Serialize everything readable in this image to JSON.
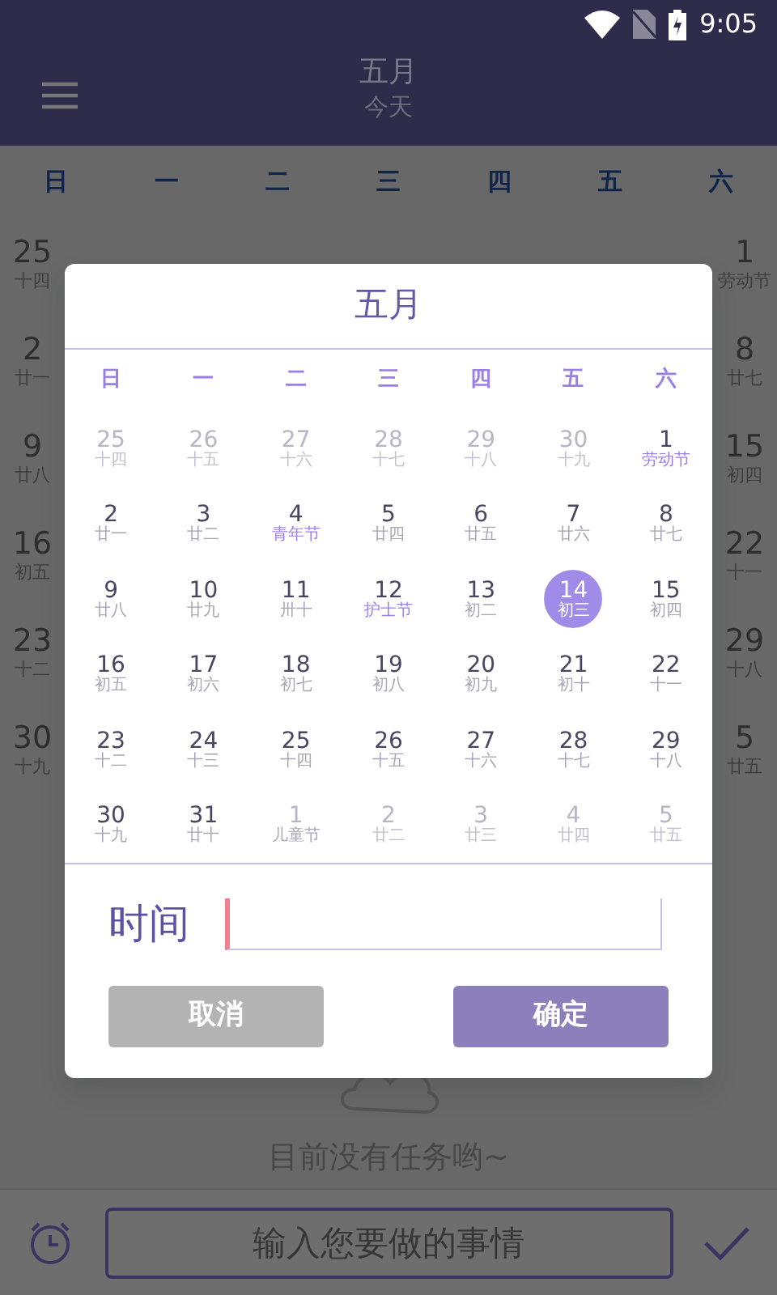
{
  "status_bar": {
    "time": "9:05"
  },
  "header": {
    "title": "五月",
    "subtitle": "今天"
  },
  "background_calendar": {
    "weekdays": [
      "日",
      "一",
      "二",
      "三",
      "四",
      "五",
      "六"
    ],
    "left_column": [
      {
        "day": "25",
        "lunar": "十四"
      },
      {
        "day": "2",
        "lunar": "廿一"
      },
      {
        "day": "9",
        "lunar": "廿八"
      },
      {
        "day": "16",
        "lunar": "初五"
      },
      {
        "day": "23",
        "lunar": "十二"
      },
      {
        "day": "30",
        "lunar": "十九"
      }
    ],
    "right_column": [
      {
        "day": "1",
        "lunar": "劳动节"
      },
      {
        "day": "8",
        "lunar": "廿七"
      },
      {
        "day": "15",
        "lunar": "初四"
      },
      {
        "day": "22",
        "lunar": "十一"
      },
      {
        "day": "29",
        "lunar": "十八"
      },
      {
        "day": "5",
        "lunar": "廿五"
      }
    ]
  },
  "empty_message": "目前没有任务哟~",
  "task_input": {
    "placeholder": "输入您要做的事情"
  },
  "dialog": {
    "title": "五月",
    "weekdays": [
      "日",
      "一",
      "二",
      "三",
      "四",
      "五",
      "六"
    ],
    "days": [
      {
        "day": "25",
        "lunar": "十四",
        "in_month": false,
        "festival": false,
        "selected": false
      },
      {
        "day": "26",
        "lunar": "十五",
        "in_month": false,
        "festival": false,
        "selected": false
      },
      {
        "day": "27",
        "lunar": "十六",
        "in_month": false,
        "festival": false,
        "selected": false
      },
      {
        "day": "28",
        "lunar": "十七",
        "in_month": false,
        "festival": false,
        "selected": false
      },
      {
        "day": "29",
        "lunar": "十八",
        "in_month": false,
        "festival": false,
        "selected": false
      },
      {
        "day": "30",
        "lunar": "十九",
        "in_month": false,
        "festival": false,
        "selected": false
      },
      {
        "day": "1",
        "lunar": "劳动节",
        "in_month": true,
        "festival": true,
        "selected": false
      },
      {
        "day": "2",
        "lunar": "廿一",
        "in_month": true,
        "festival": false,
        "selected": false
      },
      {
        "day": "3",
        "lunar": "廿二",
        "in_month": true,
        "festival": false,
        "selected": false
      },
      {
        "day": "4",
        "lunar": "青年节",
        "in_month": true,
        "festival": true,
        "selected": false
      },
      {
        "day": "5",
        "lunar": "廿四",
        "in_month": true,
        "festival": false,
        "selected": false
      },
      {
        "day": "6",
        "lunar": "廿五",
        "in_month": true,
        "festival": false,
        "selected": false
      },
      {
        "day": "7",
        "lunar": "廿六",
        "in_month": true,
        "festival": false,
        "selected": false
      },
      {
        "day": "8",
        "lunar": "廿七",
        "in_month": true,
        "festival": false,
        "selected": false
      },
      {
        "day": "9",
        "lunar": "廿八",
        "in_month": true,
        "festival": false,
        "selected": false
      },
      {
        "day": "10",
        "lunar": "廿九",
        "in_month": true,
        "festival": false,
        "selected": false
      },
      {
        "day": "11",
        "lunar": "卅十",
        "in_month": true,
        "festival": false,
        "selected": false
      },
      {
        "day": "12",
        "lunar": "护士节",
        "in_month": true,
        "festival": true,
        "selected": false
      },
      {
        "day": "13",
        "lunar": "初二",
        "in_month": true,
        "festival": false,
        "selected": false
      },
      {
        "day": "14",
        "lunar": "初三",
        "in_month": true,
        "festival": false,
        "selected": true
      },
      {
        "day": "15",
        "lunar": "初四",
        "in_month": true,
        "festival": false,
        "selected": false
      },
      {
        "day": "16",
        "lunar": "初五",
        "in_month": true,
        "festival": false,
        "selected": false
      },
      {
        "day": "17",
        "lunar": "初六",
        "in_month": true,
        "festival": false,
        "selected": false
      },
      {
        "day": "18",
        "lunar": "初七",
        "in_month": true,
        "festival": false,
        "selected": false
      },
      {
        "day": "19",
        "lunar": "初八",
        "in_month": true,
        "festival": false,
        "selected": false
      },
      {
        "day": "20",
        "lunar": "初九",
        "in_month": true,
        "festival": false,
        "selected": false
      },
      {
        "day": "21",
        "lunar": "初十",
        "in_month": true,
        "festival": false,
        "selected": false
      },
      {
        "day": "22",
        "lunar": "十一",
        "in_month": true,
        "festival": false,
        "selected": false
      },
      {
        "day": "23",
        "lunar": "十二",
        "in_month": true,
        "festival": false,
        "selected": false
      },
      {
        "day": "24",
        "lunar": "十三",
        "in_month": true,
        "festival": false,
        "selected": false
      },
      {
        "day": "25",
        "lunar": "十四",
        "in_month": true,
        "festival": false,
        "selected": false
      },
      {
        "day": "26",
        "lunar": "十五",
        "in_month": true,
        "festival": false,
        "selected": false
      },
      {
        "day": "27",
        "lunar": "十六",
        "in_month": true,
        "festival": false,
        "selected": false
      },
      {
        "day": "28",
        "lunar": "十七",
        "in_month": true,
        "festival": false,
        "selected": false
      },
      {
        "day": "29",
        "lunar": "十八",
        "in_month": true,
        "festival": false,
        "selected": false
      },
      {
        "day": "30",
        "lunar": "十九",
        "in_month": true,
        "festival": false,
        "selected": false
      },
      {
        "day": "31",
        "lunar": "廿十",
        "in_month": true,
        "festival": false,
        "selected": false
      },
      {
        "day": "1",
        "lunar": "儿童节",
        "in_month": false,
        "festival": true,
        "selected": false
      },
      {
        "day": "2",
        "lunar": "廿二",
        "in_month": false,
        "festival": false,
        "selected": false
      },
      {
        "day": "3",
        "lunar": "廿三",
        "in_month": false,
        "festival": false,
        "selected": false
      },
      {
        "day": "4",
        "lunar": "廿四",
        "in_month": false,
        "festival": false,
        "selected": false
      },
      {
        "day": "5",
        "lunar": "廿五",
        "in_month": false,
        "festival": false,
        "selected": false
      }
    ],
    "time_label": "时间",
    "buttons": [
      {
        "kind": "cancel",
        "label": "取消"
      },
      {
        "kind": "confirm",
        "label": "确定"
      }
    ]
  }
}
